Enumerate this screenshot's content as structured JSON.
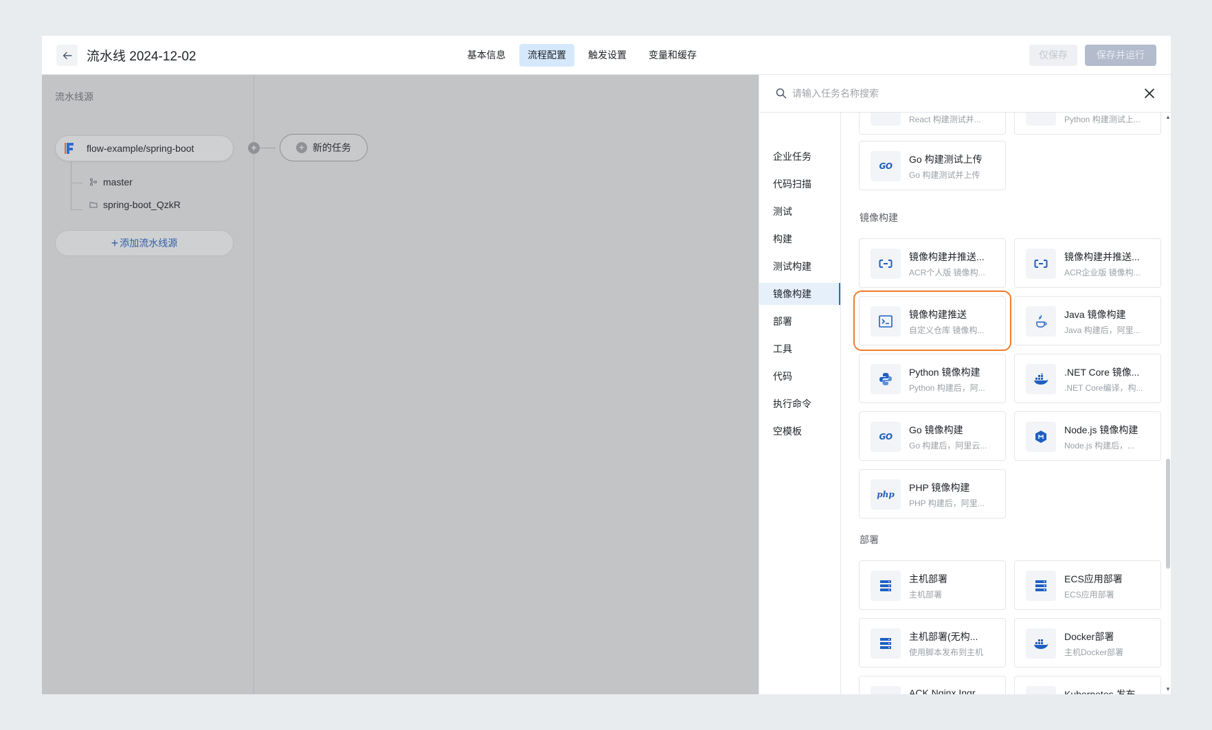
{
  "header": {
    "title": "流水线 2024-12-02",
    "tabs": [
      {
        "label": "基本信息",
        "active": false
      },
      {
        "label": "流程配置",
        "active": true
      },
      {
        "label": "触发设置",
        "active": false
      },
      {
        "label": "变量和缓存",
        "active": false
      }
    ],
    "save_label": "仅保存",
    "save_run_label": "保存并运行"
  },
  "canvas": {
    "source_section_title": "流水线源",
    "source_name": "flow-example/spring-boot",
    "branch": "master",
    "dir": "spring-boot_QzkR",
    "add_source_label": "添加流水线源",
    "new_task_label": "新的任务"
  },
  "panel": {
    "search_placeholder": "请输入任务名称搜索",
    "categories": [
      {
        "label": "企业任务"
      },
      {
        "label": "代码扫描"
      },
      {
        "label": "测试"
      },
      {
        "label": "构建"
      },
      {
        "label": "测试构建"
      },
      {
        "label": "镜像构建",
        "active": true
      },
      {
        "label": "部署"
      },
      {
        "label": "工具"
      },
      {
        "label": "代码"
      },
      {
        "label": "执行命令"
      },
      {
        "label": "空模板"
      }
    ],
    "top_partial": [
      {
        "desc": "React 构建测试并..."
      },
      {
        "desc": "Python 构建测试上..."
      }
    ],
    "go_upload": {
      "title": "Go 构建测试上传",
      "desc": "Go 构建测试并上传",
      "icon": "go-icon"
    },
    "sections": [
      {
        "title": "镜像构建",
        "cards": [
          {
            "title": "镜像构建并推送...",
            "desc": "ACR个人版 镜像构...",
            "icon": "acr-icon"
          },
          {
            "title": "镜像构建并推送...",
            "desc": "ACR企业版 镜像构...",
            "icon": "acr-icon"
          },
          {
            "title": "镜像构建推送",
            "desc": "自定义仓库 镜像构...",
            "icon": "terminal-icon",
            "highlight": true
          },
          {
            "title": "Java 镜像构建",
            "desc": "Java 构建后，阿里...",
            "icon": "java-icon"
          },
          {
            "title": "Python 镜像构建",
            "desc": "Python 构建后，阿...",
            "icon": "python-icon"
          },
          {
            "title": ".NET Core 镜像...",
            "desc": ".NET Core编译，构...",
            "icon": "docker-icon"
          },
          {
            "title": "Go 镜像构建",
            "desc": "Go 构建后，阿里云...",
            "icon": "go-icon"
          },
          {
            "title": "Node.js 镜像构建",
            "desc": "Node.js 构建后，...",
            "icon": "nodejs-icon"
          },
          {
            "title": "PHP 镜像构建",
            "desc": "PHP 构建后，阿里...",
            "icon": "php-icon"
          }
        ]
      },
      {
        "title": "部署",
        "cards": [
          {
            "title": "主机部署",
            "desc": "主机部署",
            "icon": "server-icon"
          },
          {
            "title": "ECS应用部署",
            "desc": "ECS应用部署",
            "icon": "server-icon"
          },
          {
            "title": "主机部署(无构...",
            "desc": "使用脚本发布到主机",
            "icon": "server-icon"
          },
          {
            "title": "Docker部署",
            "desc": "主机Docker部署",
            "icon": "docker-icon"
          },
          {
            "title": "ACK Nginx Ingr...",
            "desc": "",
            "icon": "kubernetes-icon"
          },
          {
            "title": "Kubernetes 发布",
            "desc": "",
            "icon": "kubernetes-icon"
          }
        ]
      }
    ]
  },
  "colors": {
    "accent": "#1f6fd1",
    "highlight_border": "#f07b2a",
    "icon_blue": "#1f5fc0"
  }
}
